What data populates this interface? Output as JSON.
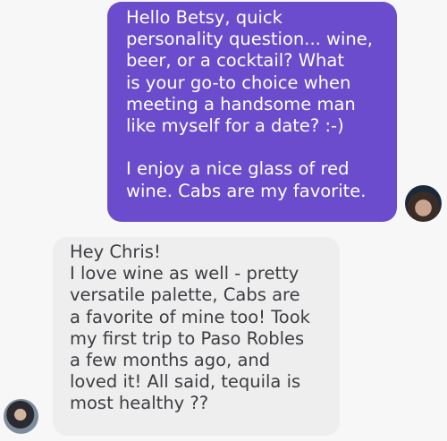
{
  "conversation": {
    "outgoing_message": {
      "sender": "Chris",
      "text": "Hello Betsy, quick\npersonality question... wine,\nbeer, or a cocktail? What\nis your go-to choice when\nmeeting a handsome man\nlike myself for a date? :-)\n\nI enjoy a nice glass of red\nwine. Cabs are my favorite.",
      "bubble_color": "#6a4ccc",
      "text_color": "#ffffff"
    },
    "incoming_message": {
      "sender": "Betsy",
      "text": "Hey Chris!\nI love wine as well - pretty\nversatile palette, Cabs are\na favorite of mine too! Took\nmy first trip to Paso Robles\na few months ago, and\nloved it! All said, tequila is\nmost healthy ??",
      "bubble_color": "#eeeeef",
      "text_color": "#3d3d42"
    },
    "avatars": {
      "right_icon": "user-avatar-photo",
      "left_icon": "user-avatar-photo"
    }
  }
}
